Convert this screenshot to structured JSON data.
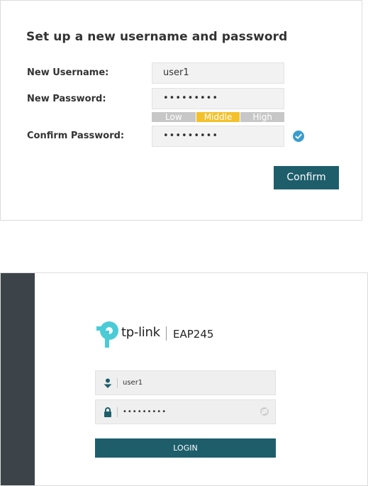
{
  "setup": {
    "title": "Set up a new username and password",
    "username_label": "New Username:",
    "username_value": "user1",
    "password_label": "New Password:",
    "password_value": "•••••••••",
    "strength_levels": [
      "Low",
      "Middle",
      "High"
    ],
    "strength_selected": "Middle",
    "confirm_label": "Confirm Password:",
    "confirm_value": "•••••••••",
    "confirm_button": "Confirm"
  },
  "login": {
    "brand": "tp-link",
    "model": "EAP245",
    "username_value": "user1",
    "password_value": "•••••••••",
    "login_button": "LOGIN"
  },
  "icons": {
    "check": "check-circle-icon",
    "user": "user-icon",
    "lock": "lock-icon",
    "eye": "eye-hidden-icon",
    "logo": "tp-link-logo-icon"
  },
  "colors": {
    "accent": "#1e5e6b",
    "strength_active": "#f3c12b",
    "strength_inactive": "#c7c7c7",
    "check": "#3a9ccf",
    "sidebar": "#3d4449"
  }
}
